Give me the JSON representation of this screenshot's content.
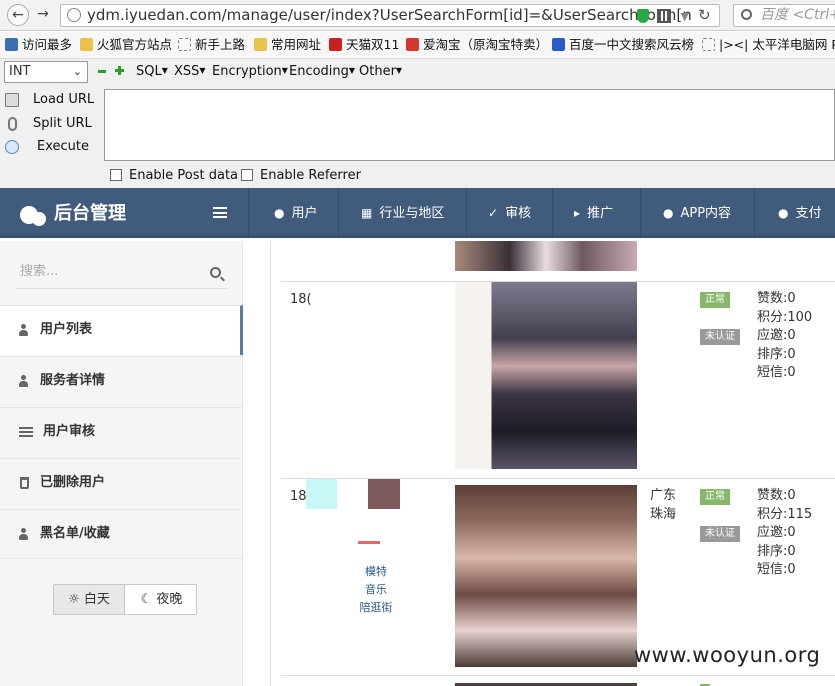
{
  "browser": {
    "url": "ydm.iyuedan.com/manage/user/index?UserSearchForm[id]=&UserSearchForm[n",
    "search_placeholder": "百度 <Ctrl+K>"
  },
  "bookmarks": [
    {
      "label": "访问最多"
    },
    {
      "label": "火狐官方站点"
    },
    {
      "label": "新手上路"
    },
    {
      "label": "常用网址"
    },
    {
      "label": "天猫双11"
    },
    {
      "label": "爱淘宝（原淘宝特卖）"
    },
    {
      "label": "百度一中文搜索风云榜"
    },
    {
      "label": "|><| 太平洋电脑网 PC"
    }
  ],
  "hackbar": {
    "select_value": "INT",
    "menus": [
      "SQL",
      "XSS",
      "Encryption",
      "Encoding",
      "Other"
    ],
    "actions": [
      "Load URL",
      "Split URL",
      "Execute"
    ],
    "checkboxes": [
      "Enable Post data",
      "Enable Referrer"
    ]
  },
  "app": {
    "title": "后台管理",
    "nav": [
      "用户",
      "行业与地区",
      "审核",
      "推广",
      "APP内容",
      "支付"
    ]
  },
  "sidebar": {
    "search_placeholder": "搜索...",
    "items": [
      {
        "label": "用户列表",
        "active": true
      },
      {
        "label": "服务者详情",
        "active": false
      },
      {
        "label": "用户审核",
        "active": false
      },
      {
        "label": "已删除用户",
        "active": false
      },
      {
        "label": "黑名单/收藏",
        "active": false
      }
    ],
    "theme_day": "白天",
    "theme_night": "夜晚"
  },
  "rows": [
    {
      "uid": "18(",
      "city": "",
      "status": "正常",
      "auth": "未认证",
      "stats": [
        "赞数:0",
        "积分:100",
        "应邀:0",
        "排序:0",
        "短信:0"
      ]
    },
    {
      "uid": "18(",
      "city": "广东珠海",
      "city_line1": "广东",
      "city_line2": "珠海",
      "status": "正常",
      "auth": "未认证",
      "tags": [
        "模特",
        "音乐",
        "陪逛街"
      ],
      "stats": [
        "赞数:0",
        "积分:115",
        "应邀:0",
        "排序:0",
        "短信:0"
      ]
    }
  ],
  "watermark": "www.wooyun.org",
  "colors": {
    "navbar": "#415b7c",
    "status_green": "#87b86a",
    "tag_gray": "#9a9a9a"
  }
}
